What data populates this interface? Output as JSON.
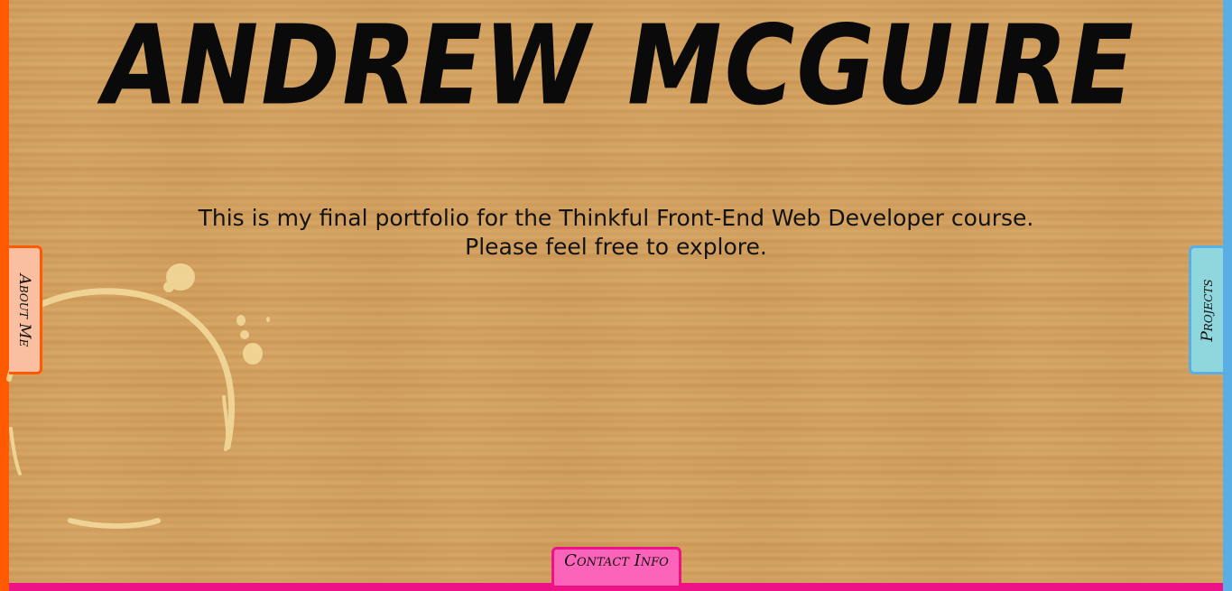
{
  "header": {
    "title": "ANDREW MCGUIRE"
  },
  "intro": {
    "line1": "This is my final portfolio for the Thinkful Front-End Web Developer course.",
    "line2": "Please feel free to explore."
  },
  "tabs": {
    "about_label": "About Me",
    "projects_label": "Projects",
    "contact_label": "Contact Info"
  },
  "colors": {
    "desk": "#d6a665",
    "about_accent": "#ff5a00",
    "about_fill": "#f9bfa0",
    "projects_accent": "#5aaee6",
    "projects_fill": "#8fd7dd",
    "contact_accent": "#ee1287",
    "contact_fill": "#fb64b8",
    "stain": "#f2d99a"
  },
  "decor": {
    "stain_icon": "coffee-ring-icon"
  }
}
